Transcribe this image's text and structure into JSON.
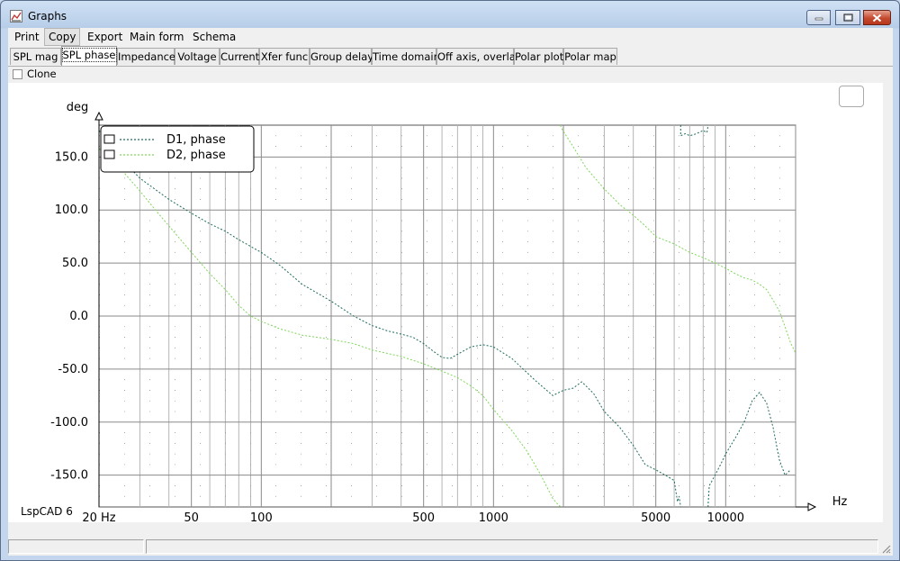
{
  "window": {
    "title": "Graphs"
  },
  "menu": [
    "Print",
    "Copy",
    "Export",
    "Main form",
    "Schema"
  ],
  "tabs": [
    "SPL mag",
    "SPL phase",
    "Impedance",
    "Voltage",
    "Current",
    "Xfer func",
    "Group delay",
    "Time domain",
    "Off axis, overlay",
    "Polar plot",
    "Polar map"
  ],
  "selected_tab": "SPL phase",
  "clone_label": "Clone",
  "footer_label": "LspCAD 6",
  "colors": {
    "d1": "#1d6b5e",
    "d2": "#7fd65a",
    "grid": "#7a7a7a"
  },
  "chart_data": {
    "type": "line",
    "title": "",
    "xlabel": "Hz",
    "ylabel": "deg",
    "xscale": "log",
    "xlim": [
      20,
      20000
    ],
    "ylim": [
      -180,
      180
    ],
    "x_tick_labels": [
      "20 Hz",
      "50",
      "100",
      "500",
      "1000",
      "5000",
      "10000"
    ],
    "x_tick_values": [
      20,
      50,
      100,
      500,
      1000,
      5000,
      10000
    ],
    "y_ticks": [
      150,
      100,
      50,
      0,
      -50,
      -100,
      -150
    ],
    "y_tick_labels": [
      "150.0",
      "100.0",
      "50.0",
      "0.0",
      "-50.0",
      "-100.0",
      "-150.0"
    ],
    "grid": true,
    "legend_position": "top-left",
    "series": [
      {
        "name": "D1, phase",
        "style": "dotted",
        "color": "#1d6b5e",
        "points": [
          [
            20,
            175
          ],
          [
            25,
            148
          ],
          [
            30,
            130
          ],
          [
            40,
            110
          ],
          [
            50,
            97
          ],
          [
            60,
            87
          ],
          [
            70,
            80
          ],
          [
            80,
            72
          ],
          [
            100,
            60
          ],
          [
            120,
            48
          ],
          [
            150,
            30
          ],
          [
            200,
            14
          ],
          [
            250,
            0
          ],
          [
            300,
            -9
          ],
          [
            350,
            -14
          ],
          [
            400,
            -17
          ],
          [
            450,
            -20
          ],
          [
            500,
            -26
          ],
          [
            550,
            -33
          ],
          [
            600,
            -39
          ],
          [
            650,
            -40
          ],
          [
            700,
            -36
          ],
          [
            800,
            -29
          ],
          [
            900,
            -27
          ],
          [
            1000,
            -29
          ],
          [
            1200,
            -40
          ],
          [
            1500,
            -60
          ],
          [
            1800,
            -75
          ],
          [
            2000,
            -70
          ],
          [
            2200,
            -68
          ],
          [
            2400,
            -62
          ],
          [
            2700,
            -73
          ],
          [
            3000,
            -90
          ],
          [
            3500,
            -105
          ],
          [
            4000,
            -122
          ],
          [
            4500,
            -140
          ],
          [
            5000,
            -145
          ],
          [
            5500,
            -150
          ],
          [
            6000,
            -155
          ],
          [
            6200,
            -175
          ],
          [
            6300,
            -170
          ],
          [
            6400,
            170
          ],
          [
            6700,
            172
          ],
          [
            7000,
            170
          ],
          [
            7500,
            172
          ],
          [
            8000,
            175
          ],
          [
            8300,
            173
          ],
          [
            8400,
            -178
          ],
          [
            8500,
            -160
          ],
          [
            9000,
            -150
          ],
          [
            9500,
            -140
          ],
          [
            10000,
            -130
          ],
          [
            11000,
            -115
          ],
          [
            12000,
            -100
          ],
          [
            13000,
            -80
          ],
          [
            14000,
            -72
          ],
          [
            15000,
            -82
          ],
          [
            16000,
            -105
          ],
          [
            17000,
            -135
          ],
          [
            18000,
            -150
          ],
          [
            19000,
            -145
          ]
        ]
      },
      {
        "name": "D2, phase",
        "style": "dotted",
        "color": "#7fd65a",
        "points": [
          [
            20,
            158
          ],
          [
            25,
            138
          ],
          [
            30,
            118
          ],
          [
            35,
            100
          ],
          [
            40,
            85
          ],
          [
            50,
            60
          ],
          [
            60,
            40
          ],
          [
            70,
            25
          ],
          [
            80,
            10
          ],
          [
            90,
            0
          ],
          [
            100,
            -5
          ],
          [
            120,
            -12
          ],
          [
            150,
            -18
          ],
          [
            200,
            -22
          ],
          [
            250,
            -26
          ],
          [
            300,
            -32
          ],
          [
            400,
            -38
          ],
          [
            500,
            -45
          ],
          [
            600,
            -52
          ],
          [
            700,
            -58
          ],
          [
            800,
            -66
          ],
          [
            900,
            -75
          ],
          [
            1000,
            -88
          ],
          [
            1200,
            -108
          ],
          [
            1400,
            -128
          ],
          [
            1600,
            -150
          ],
          [
            1800,
            -172
          ],
          [
            1900,
            -178
          ],
          [
            1950,
            178
          ],
          [
            2200,
            160
          ],
          [
            2500,
            140
          ],
          [
            3000,
            120
          ],
          [
            3500,
            105
          ],
          [
            4000,
            95
          ],
          [
            4500,
            85
          ],
          [
            5000,
            75
          ],
          [
            6000,
            68
          ],
          [
            7000,
            60
          ],
          [
            8000,
            55
          ],
          [
            9000,
            50
          ],
          [
            10000,
            45
          ],
          [
            11000,
            40
          ],
          [
            12000,
            36
          ],
          [
            13000,
            34
          ],
          [
            14000,
            30
          ],
          [
            15000,
            25
          ],
          [
            16000,
            15
          ],
          [
            17000,
            5
          ],
          [
            18000,
            -10
          ],
          [
            19000,
            -25
          ],
          [
            20000,
            -35
          ]
        ]
      }
    ]
  }
}
